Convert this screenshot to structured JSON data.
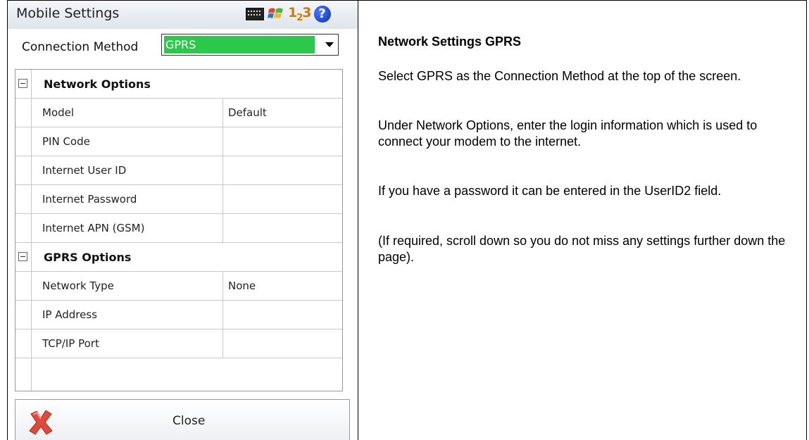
{
  "device": {
    "title": "Mobile Settings",
    "tray": {
      "ime": "1",
      "ime_sub": "2",
      "ime_tail": "3",
      "help": "?"
    },
    "connection_method_label": "Connection Method",
    "connection_method_value": "GPRS",
    "sections": [
      {
        "label": "Network Options",
        "properties": [
          {
            "name": "Model",
            "value": "Default"
          },
          {
            "name": "PIN Code",
            "value": ""
          },
          {
            "name": "Internet User ID",
            "value": ""
          },
          {
            "name": "Internet Password",
            "value": ""
          },
          {
            "name": "Internet APN (GSM)",
            "value": ""
          }
        ]
      },
      {
        "label": "GPRS Options",
        "properties": [
          {
            "name": "Network Type",
            "value": "None"
          },
          {
            "name": "IP Address",
            "value": ""
          },
          {
            "name": "TCP/IP Port",
            "value": ""
          }
        ]
      }
    ],
    "close_label": "Close",
    "colors": {
      "selection": "#2cc84b",
      "close_x": "#e04a3a"
    }
  },
  "instructions": {
    "title": "Network Settings GPRS",
    "paragraphs": [
      "Select GPRS as the Connection Method at the top of the screen.",
      "Under Network Options, enter the login information which is used to connect your modem to the internet.",
      "If you have a password it can be entered in the UserID2 field.",
      "(If required, scroll down so you do not miss any settings further down the   page)."
    ]
  }
}
